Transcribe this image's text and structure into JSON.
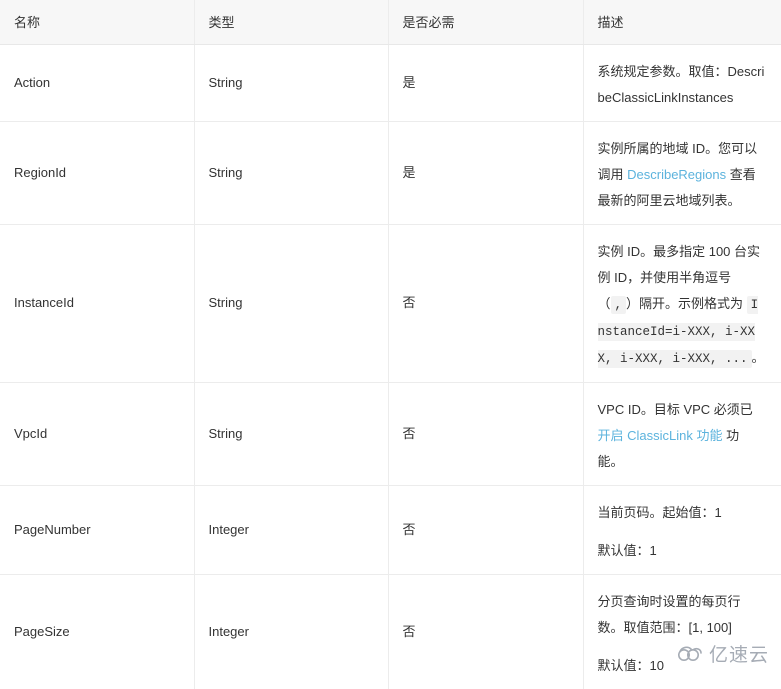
{
  "table": {
    "columns": [
      {
        "key": "name",
        "label": "名称"
      },
      {
        "key": "type",
        "label": "类型"
      },
      {
        "key": "required",
        "label": "是否必需"
      },
      {
        "key": "description",
        "label": "描述"
      }
    ],
    "rows": [
      {
        "name": "Action",
        "type": "String",
        "required": "是",
        "description_parts": [
          {
            "type": "text",
            "text": "系统规定参数。取值：DescribeClassicLinkInstances"
          }
        ],
        "description_plain": "系统规定参数。取值：DescribeClassicLinkInstances"
      },
      {
        "name": "RegionId",
        "type": "String",
        "required": "是",
        "description_parts": [
          {
            "type": "text",
            "text": "实例所属的地域 ID。您可以调用 "
          },
          {
            "type": "link",
            "text": "DescribeRegions"
          },
          {
            "type": "text",
            "text": " 查看最新的阿里云地域列表。"
          }
        ],
        "description_plain": "实例所属的地域 ID。您可以调用 DescribeRegions 查看最新的阿里云地域列表。"
      },
      {
        "name": "InstanceId",
        "type": "String",
        "required": "否",
        "description_parts": [
          {
            "type": "text",
            "text": "实例 ID。最多指定 100 台实例 ID，并使用半角逗号（"
          },
          {
            "type": "code",
            "text": ","
          },
          {
            "type": "text",
            "text": "）隔开。示例格式为 "
          },
          {
            "type": "code",
            "text": "InstanceId=i-XXX, i-XXX, i-XXX, i-XXX, ..."
          },
          {
            "type": "text",
            "text": "。"
          }
        ],
        "description_plain": "实例 ID。最多指定 100 台实例 ID，并使用半角逗号（,）隔开。示例格式为 InstanceId=i-XXX, i-XXX, i-XXX, i-XXX, ...。"
      },
      {
        "name": "VpcId",
        "type": "String",
        "required": "否",
        "description_parts": [
          {
            "type": "text",
            "text": "VPC ID。目标 VPC 必须已"
          },
          {
            "type": "link",
            "text": "开启 ClassicLink 功能"
          },
          {
            "type": "text",
            "text": " 功能。"
          }
        ],
        "description_plain": "VPC ID。目标 VPC 必须已开启 ClassicLink 功能 功能。"
      },
      {
        "name": "PageNumber",
        "type": "Integer",
        "required": "否",
        "description_paragraphs": [
          "当前页码。起始值：1",
          "默认值：1"
        ],
        "description_plain": "当前页码。起始值：1 默认值：1"
      },
      {
        "name": "PageSize",
        "type": "Integer",
        "required": "否",
        "description_paragraphs": [
          "分页查询时设置的每页行数。取值范围：[1, 100]",
          "默认值：10"
        ],
        "description_plain": "分页查询时设置的每页行数。取值范围：[1, 100] 默认值：10"
      }
    ]
  },
  "watermark": {
    "text": "亿速云",
    "icon": "cloud-icon",
    "color": "#a6acb5"
  },
  "colors": {
    "link": "#5cb3dd",
    "header_background": "#f7f7f7",
    "border": "#ececec",
    "text": "#333333",
    "code_background": "#f2f2f2"
  }
}
